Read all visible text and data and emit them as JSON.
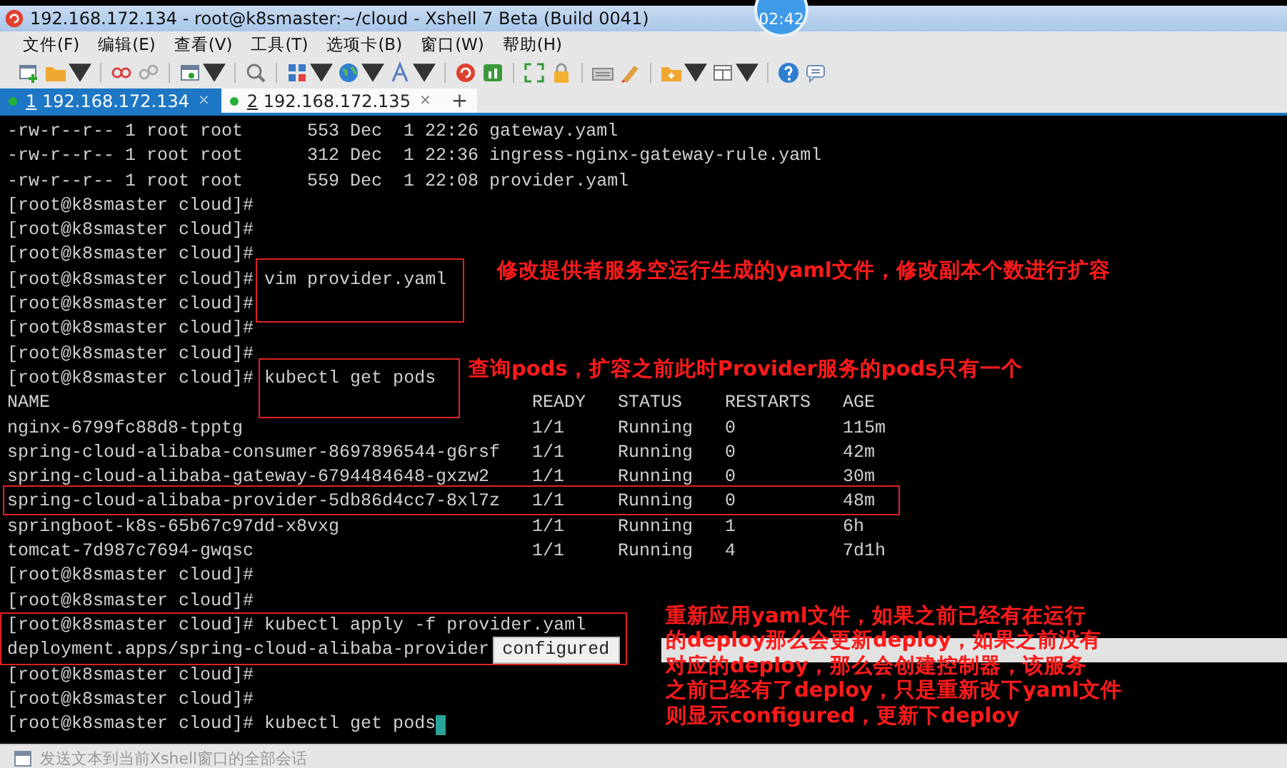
{
  "window": {
    "title": "192.168.172.134 - root@k8smaster:~/cloud - Xshell 7 Beta (Build 0041)",
    "timer": "02:42"
  },
  "menu": [
    "文件(F)",
    "编辑(E)",
    "查看(V)",
    "工具(T)",
    "选项卡(B)",
    "窗口(W)",
    "帮助(H)"
  ],
  "tabs": [
    {
      "number": "1",
      "label": "192.168.172.134",
      "close": "×",
      "selected": true
    },
    {
      "number": "2",
      "label": "192.168.172.135",
      "close": "×",
      "selected": false
    }
  ],
  "new_tab": "+",
  "terminal": {
    "lines": [
      {
        "kind": "output",
        "text": "-rw-r--r-- 1 root root      553 Dec  1 22:26 gateway.yaml"
      },
      {
        "kind": "output",
        "text": "-rw-r--r-- 1 root root      312 Dec  1 22:36 ingress-nginx-gateway-rule.yaml"
      },
      {
        "kind": "output",
        "text": "-rw-r--r-- 1 root root      559 Dec  1 22:08 provider.yaml"
      },
      {
        "kind": "prompt",
        "prompt": "[root@k8smaster cloud]#"
      },
      {
        "kind": "prompt",
        "prompt": "[root@k8smaster cloud]#"
      },
      {
        "kind": "prompt",
        "prompt": "[root@k8smaster cloud]#"
      },
      {
        "kind": "prompt",
        "prompt": "[root@k8smaster cloud]#",
        "command": "vim provider.yaml"
      },
      {
        "kind": "prompt",
        "prompt": "[root@k8smaster cloud]#"
      },
      {
        "kind": "prompt",
        "prompt": "[root@k8smaster cloud]#"
      },
      {
        "kind": "prompt",
        "prompt": "[root@k8smaster cloud]#"
      },
      {
        "kind": "prompt",
        "prompt": "[root@k8smaster cloud]#",
        "command": "kubectl get pods"
      },
      {
        "kind": "table_row",
        "cells": [
          "NAME",
          "READY",
          "STATUS",
          "RESTARTS",
          "AGE"
        ]
      },
      {
        "kind": "table_row",
        "cells": [
          "nginx-6799fc88d8-tpptg",
          "1/1",
          "Running",
          "0",
          "115m"
        ]
      },
      {
        "kind": "table_row",
        "cells": [
          "spring-cloud-alibaba-consumer-8697896544-g6rsf",
          "1/1",
          "Running",
          "0",
          "42m"
        ]
      },
      {
        "kind": "table_row",
        "cells": [
          "spring-cloud-alibaba-gateway-6794484648-gxzw2",
          "1/1",
          "Running",
          "0",
          "30m"
        ]
      },
      {
        "kind": "table_row",
        "cells": [
          "spring-cloud-alibaba-provider-5db86d4cc7-8xl7z",
          "1/1",
          "Running",
          "0",
          "48m"
        ]
      },
      {
        "kind": "table_row",
        "cells": [
          "springboot-k8s-65b67c97dd-x8vxg",
          "1/1",
          "Running",
          "1",
          "6h"
        ]
      },
      {
        "kind": "table_row",
        "cells": [
          "tomcat-7d987c7694-gwqsc",
          "1/1",
          "Running",
          "4",
          "7d1h"
        ]
      },
      {
        "kind": "prompt",
        "prompt": "[root@k8smaster cloud]#"
      },
      {
        "kind": "prompt",
        "prompt": "[root@k8smaster cloud]#"
      },
      {
        "kind": "prompt",
        "prompt": "[root@k8smaster cloud]#",
        "command": "kubectl apply -f provider.yaml"
      },
      {
        "kind": "output",
        "text": "deployment.apps/spring-cloud-alibaba-provider",
        "tag": "configured"
      },
      {
        "kind": "prompt",
        "prompt": "[root@k8smaster cloud]#"
      },
      {
        "kind": "prompt",
        "prompt": "[root@k8smaster cloud]#"
      },
      {
        "kind": "prompt",
        "prompt": "[root@k8smaster cloud]#",
        "command": "kubectl get pods",
        "cursor": true
      }
    ]
  },
  "annotations": [
    {
      "lines": [
        "修改提供者服务空运行生成的yaml文件，修改副本个数进行扩容"
      ]
    },
    {
      "lines": [
        "查询pods，扩容之前此时Provider服务的pods只有一个"
      ]
    },
    {
      "lines": [
        "重新应用yaml文件，如果之前已经有在运行",
        "的deploy那么会更新deploy，如果之前没有",
        "对应的deploy，那么会创建控制器，该服务",
        "之前已经有了deploy，只是重新改下yaml文件",
        "则显示configured，更新下deploy"
      ]
    }
  ],
  "status_bar": {
    "placeholder": "发送文本到当前Xshell窗口的全部会话"
  }
}
